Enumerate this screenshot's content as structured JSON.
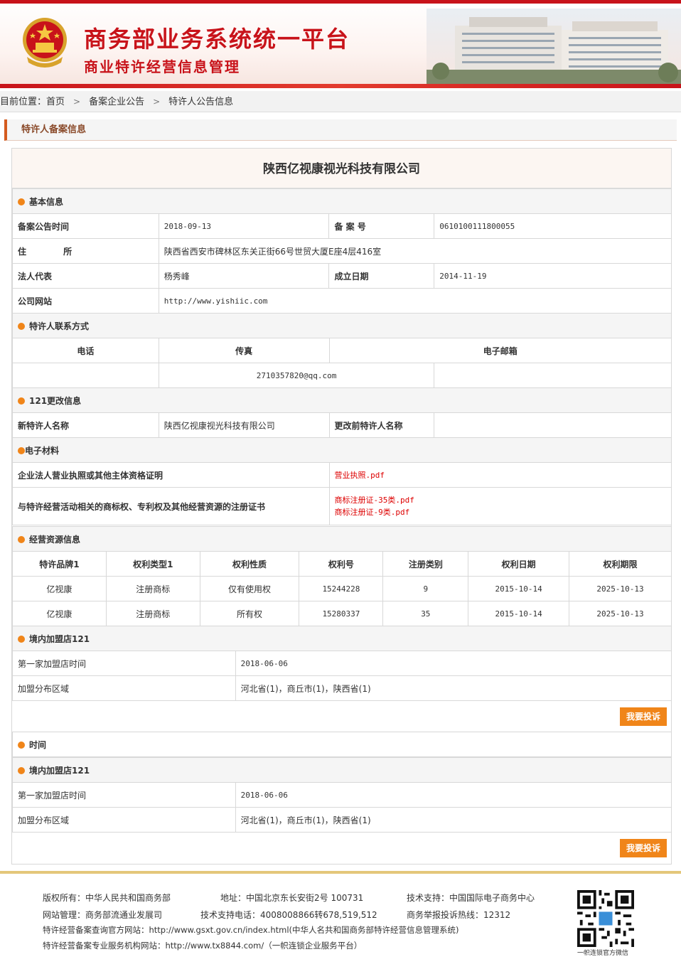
{
  "header": {
    "title_main": "商务部业务系统统一平台",
    "title_sub": "商业特许经营信息管理"
  },
  "breadcrumb": {
    "prefix": "目前位置：",
    "items": [
      "首页",
      "备案企业公告",
      "特许人公告信息"
    ]
  },
  "section_title": "特许人备案信息",
  "company_name": "陕西亿视康视光科技有限公司",
  "basic": {
    "title": "基本信息",
    "labels": {
      "filing_date": "备案公告时间",
      "filing_no": "备 案 号",
      "address": "住 所",
      "legal_rep": "法人代表",
      "established": "成立日期",
      "website": "公司网站"
    },
    "filing_date": "2018-09-13",
    "filing_no": "0610100111800055",
    "address": "陕西省西安市碑林区东关正街66号世贸大厦E座4层416室",
    "legal_rep": "杨秀峰",
    "established": "2014-11-19",
    "website": "http://www.yishiic.com"
  },
  "contact": {
    "title": "特许人联系方式",
    "headers": [
      "电话",
      "传真",
      "电子邮箱"
    ],
    "email": "2710357820@qq.com"
  },
  "change": {
    "title": "121更改信息",
    "new_label": "新特许人名称",
    "new_value": "陕西亿视康视光科技有限公司",
    "old_label": "更改前特许人名称",
    "old_value": ""
  },
  "materials": {
    "title": "电子材料",
    "row1_label": "企业法人营业执照或其他主体资格证明",
    "row1_files": [
      "营业执照.pdf"
    ],
    "row2_label": "与特许经营活动相关的商标权、专利权及其他经营资源的注册证书",
    "row2_files": [
      "商标注册证-35类.pdf",
      "商标注册证-9类.pdf"
    ]
  },
  "resources": {
    "title": "经营资源信息",
    "headers": [
      "特许品牌1",
      "权利类型1",
      "权利性质",
      "权利号",
      "注册类别",
      "权利日期",
      "权利期限"
    ],
    "rows": [
      [
        "亿视康",
        "注册商标",
        "仅有使用权",
        "15244228",
        "9",
        "2015-10-14",
        "2025-10-13"
      ],
      [
        "亿视康",
        "注册商标",
        "所有权",
        "15280337",
        "35",
        "2015-10-14",
        "2025-10-13"
      ]
    ]
  },
  "stores1": {
    "title": "境内加盟店121",
    "first_label": "第一家加盟店时间",
    "first_value": "2018-06-06",
    "area_label": "加盟分布区域",
    "area_value": "河北省(1)，商丘市(1)，陕西省(1)"
  },
  "time_title": "时间",
  "stores2": {
    "title": "境内加盟店121",
    "first_label": "第一家加盟店时间",
    "first_value": "2018-06-06",
    "area_label": "加盟分布区域",
    "area_value": "河北省(1)，商丘市(1)，陕西省(1)"
  },
  "complain_button": "我要投诉",
  "footer": {
    "copyright": "版权所有：中华人民共和国商务部",
    "address": "地址：中国北京东长安街2号 100731",
    "tech_support": "技术支持：中国国际电子商务中心",
    "site_admin": "网站管理：商务部流通业发展司",
    "tech_phone": "技术支持电话：4008008866转678,519,512",
    "report_phone": "商务举报投诉热线：12312",
    "official_site": "特许经营备案查询官方网站：http://www.gsxt.gov.cn/index.html(中华人名共和国商务部特许经营信息管理系统)",
    "service_site": "特许经营备案专业服务机构网站：http://www.tx8844.com/（一帜连锁企业服务平台）",
    "qr_caption": "一帜连锁官方微信"
  },
  "colors": {
    "brand_red": "#c8131a",
    "accent_orange": "#f08519",
    "link_red": "#dd0000"
  }
}
